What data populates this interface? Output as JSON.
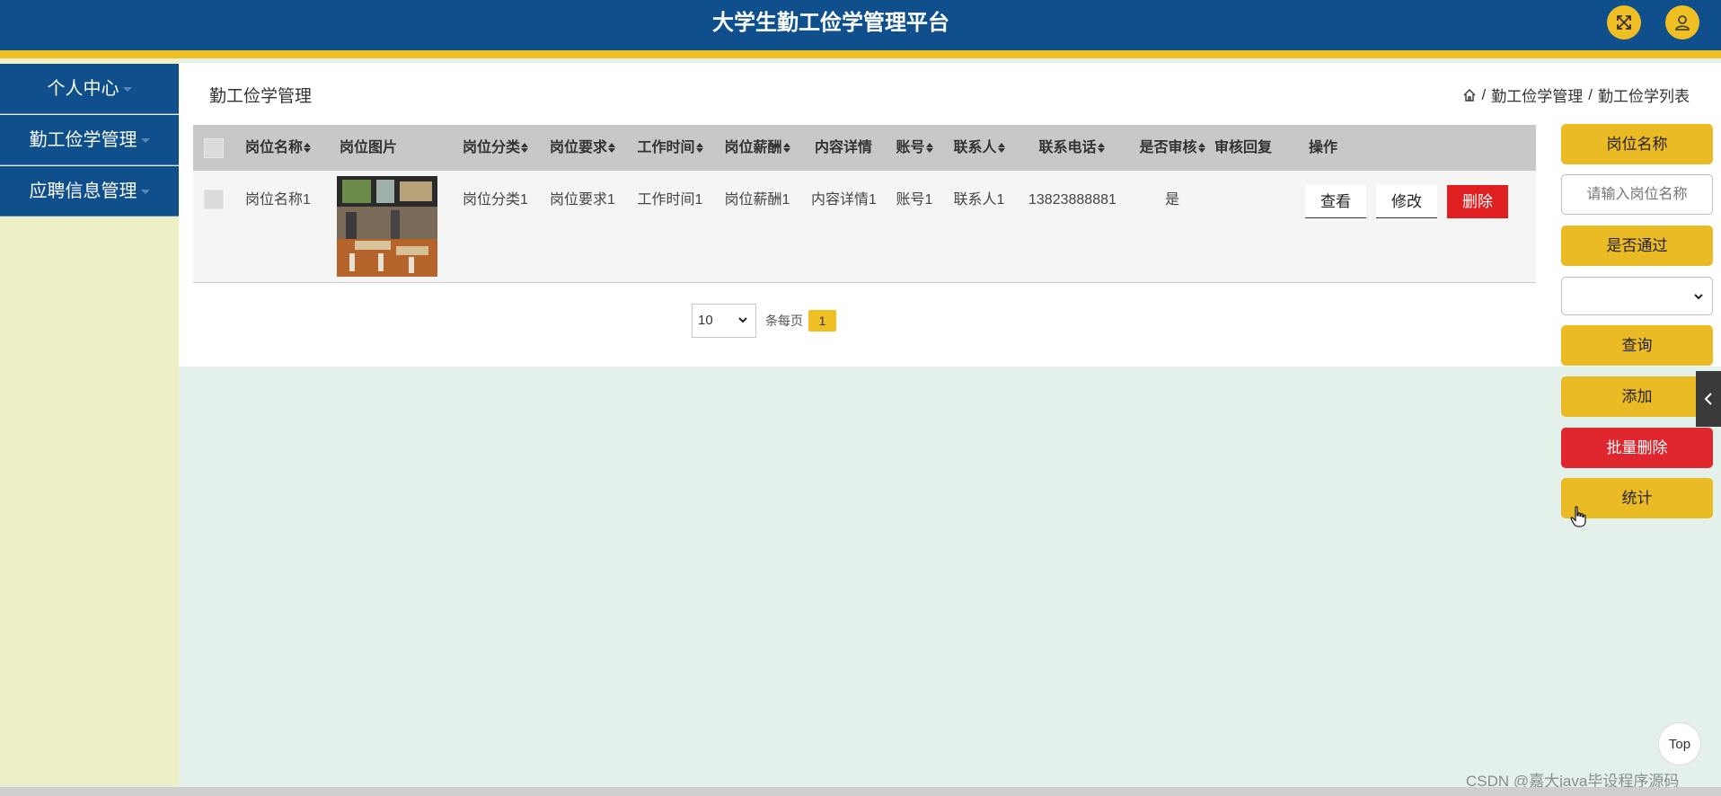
{
  "header": {
    "title": "大学生勤工俭学管理平台",
    "fullscreen_icon": "expand-icon",
    "user_icon": "user-icon"
  },
  "sidebar": {
    "items": [
      {
        "label": "个人中心"
      },
      {
        "label": "勤工俭学管理"
      },
      {
        "label": "应聘信息管理"
      }
    ]
  },
  "page": {
    "title": "勤工俭学管理",
    "breadcrumb": [
      "勤工俭学管理",
      "勤工俭学列表"
    ]
  },
  "table": {
    "columns": [
      "岗位名称",
      "岗位图片",
      "岗位分类",
      "岗位要求",
      "工作时间",
      "岗位薪酬",
      "内容详情",
      "账号",
      "联系人",
      "联系电话",
      "是否审核",
      "审核回复",
      "操作"
    ],
    "rows": [
      {
        "name": "岗位名称1",
        "category": "岗位分类1",
        "requirement": "岗位要求1",
        "work_time": "工作时间1",
        "salary": "岗位薪酬1",
        "detail": "内容详情1",
        "account": "账号1",
        "contact": "联系人1",
        "phone": "13823888881",
        "approved": "是",
        "reply": "",
        "actions": {
          "view": "查看",
          "edit": "修改",
          "delete": "删除"
        }
      }
    ]
  },
  "pagination": {
    "page_size": "10",
    "per_page_label": "条每页",
    "current_page": "1"
  },
  "search_panel": {
    "name_label": "岗位名称",
    "name_placeholder": "请输入岗位名称",
    "pass_label": "是否通过",
    "pass_value": "",
    "query_button": "查询",
    "add_button": "添加",
    "batch_delete_button": "批量删除",
    "stats_button": "统计"
  },
  "back_to_top": "Top",
  "watermark": "CSDN @嘉大java毕设程序源码",
  "colors": {
    "header": "#0e4f8c",
    "accent": "#f0bf24",
    "danger": "#e02020",
    "sidebar_bg": "#edf0c6",
    "content_bg": "#e4f0ea"
  }
}
